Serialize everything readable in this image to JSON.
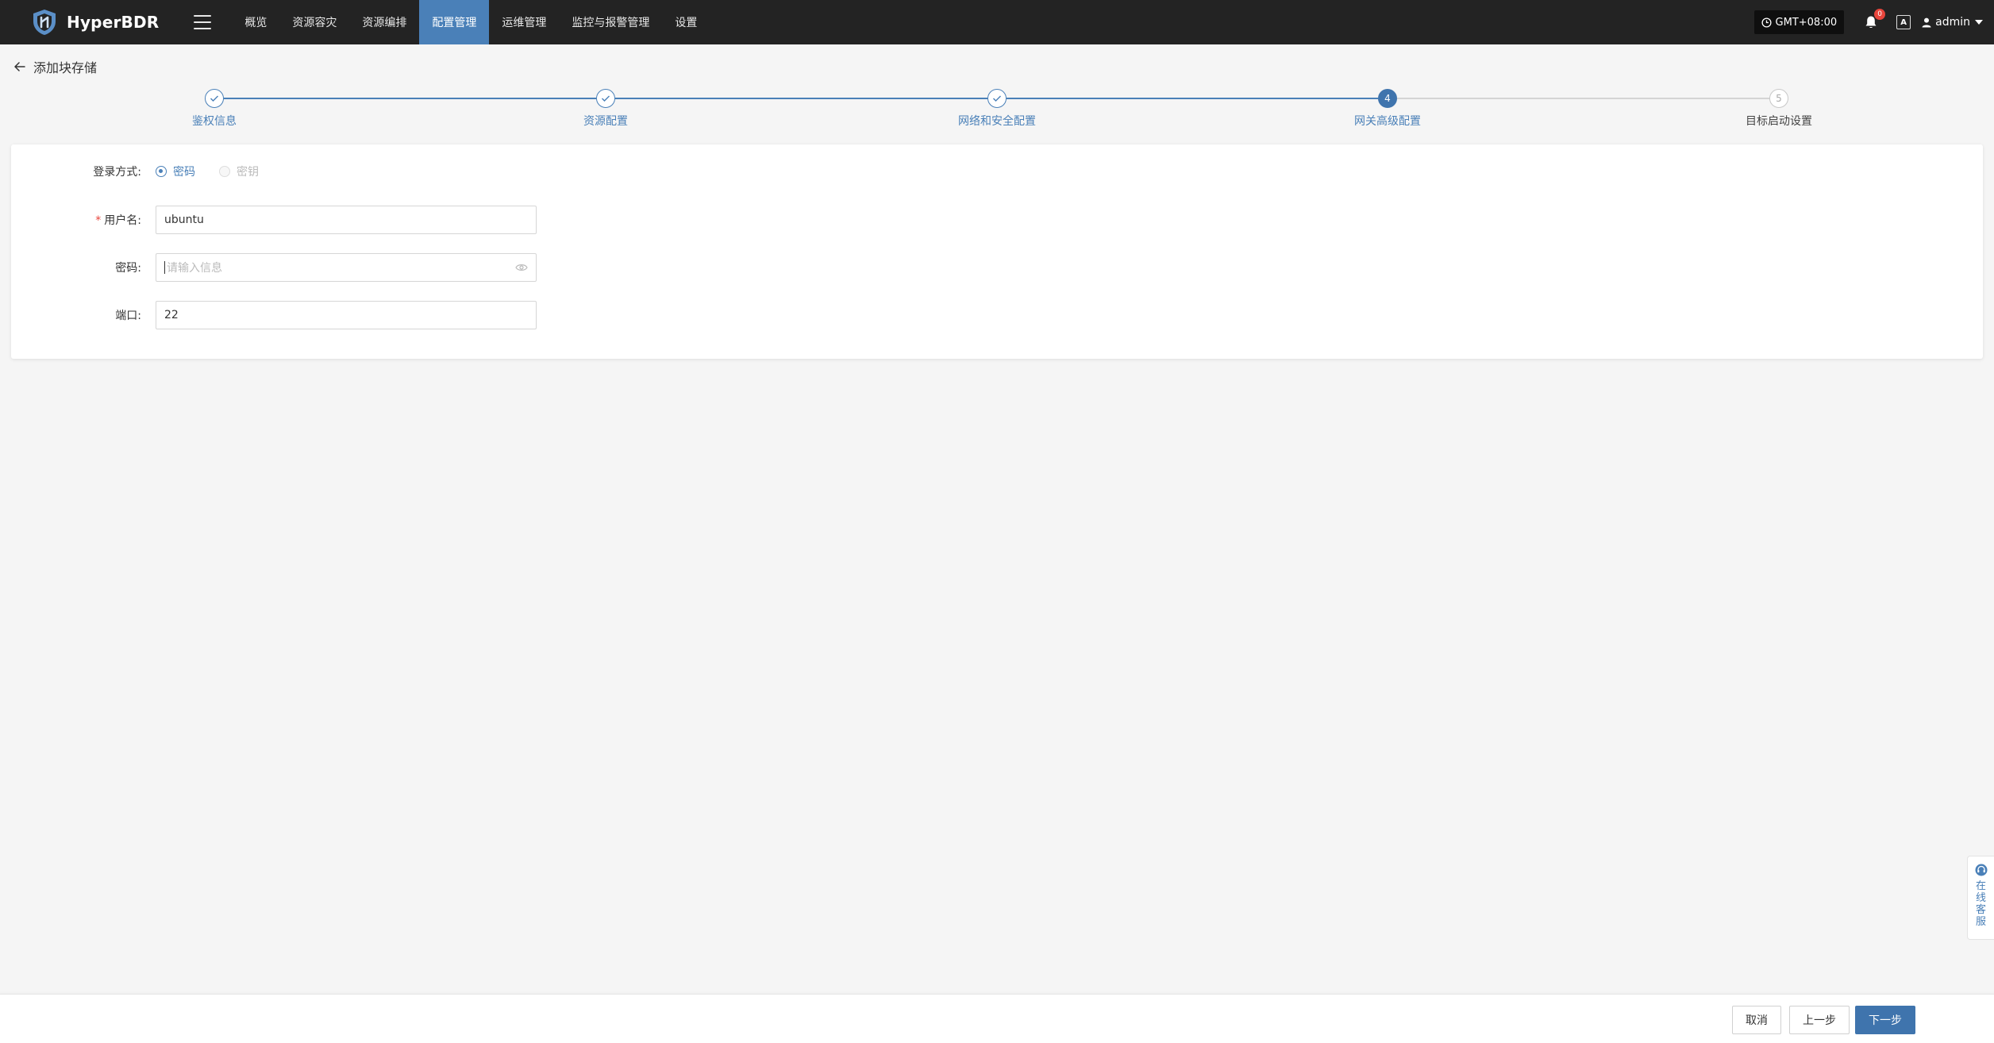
{
  "header": {
    "brand": "HyperBDR",
    "nav": [
      "概览",
      "资源容灾",
      "资源编排",
      "配置管理",
      "运维管理",
      "监控与报警管理",
      "设置"
    ],
    "active_nav_index": 3,
    "timezone": "GMT+08:00",
    "notification_count": "0",
    "lang_icon_text": "A",
    "user": "admin",
    "colors": {
      "bar": "#232323",
      "active": "#4a80b8"
    }
  },
  "page": {
    "title": "添加块存储"
  },
  "steps": [
    {
      "label": "鉴权信息",
      "status": "done",
      "number": "1"
    },
    {
      "label": "资源配置",
      "status": "done",
      "number": "2"
    },
    {
      "label": "网络和安全配置",
      "status": "done",
      "number": "3"
    },
    {
      "label": "网关高级配置",
      "status": "current",
      "number": "4"
    },
    {
      "label": "目标启动设置",
      "status": "pending",
      "number": "5"
    }
  ],
  "form": {
    "login_method_label": "登录方式:",
    "login_options": [
      {
        "label": "密码",
        "checked": true,
        "disabled": false
      },
      {
        "label": "密钥",
        "checked": false,
        "disabled": true
      }
    ],
    "username_label": "用户名:",
    "username_value": "ubuntu",
    "password_label": "密码:",
    "password_placeholder": "请输入信息",
    "port_label": "端口:",
    "port_value": "22"
  },
  "footer": {
    "cancel": "取消",
    "prev": "上一步",
    "next": "下一步"
  },
  "service_widget": {
    "text": "在线客服"
  }
}
